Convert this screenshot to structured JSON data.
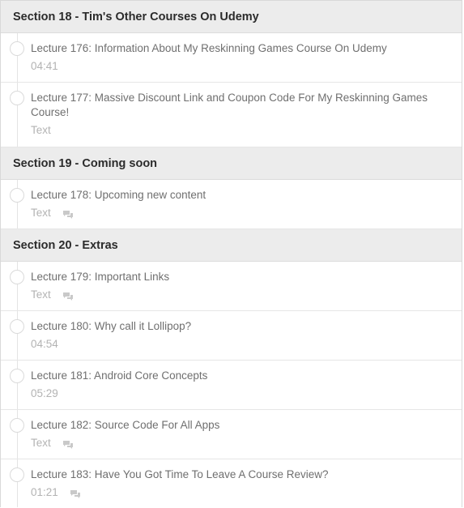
{
  "sections": [
    {
      "title": "Section 18 - Tim's Other Courses On Udemy",
      "lectures": [
        {
          "title": "Lecture 176: Information About My Reskinning Games Course On Udemy",
          "meta": "04:41",
          "comments": false
        },
        {
          "title": "Lecture 177: Massive Discount Link and Coupon Code For My Reskinning Games Course!",
          "meta": "Text",
          "comments": false
        }
      ]
    },
    {
      "title": "Section 19 - Coming soon",
      "lectures": [
        {
          "title": "Lecture 178: Upcoming new content",
          "meta": "Text",
          "comments": true
        }
      ]
    },
    {
      "title": "Section 20 - Extras",
      "lectures": [
        {
          "title": "Lecture 179: Important Links",
          "meta": "Text",
          "comments": true
        },
        {
          "title": "Lecture 180: Why call it Lollipop?",
          "meta": "04:54",
          "comments": false
        },
        {
          "title": "Lecture 181: Android Core Concepts",
          "meta": "05:29",
          "comments": false
        },
        {
          "title": "Lecture 182: Source Code For All Apps",
          "meta": "Text",
          "comments": true
        },
        {
          "title": "Lecture 183: Have You Got Time To Leave A Course Review?",
          "meta": "01:21",
          "comments": true
        }
      ]
    }
  ],
  "icons": {
    "status": "incomplete-circle-icon",
    "comments": "comment-bubble-icon"
  },
  "colors": {
    "section_bg": "#ececec",
    "title_text": "#6f6f6f",
    "meta_text": "#b3b3b3"
  }
}
